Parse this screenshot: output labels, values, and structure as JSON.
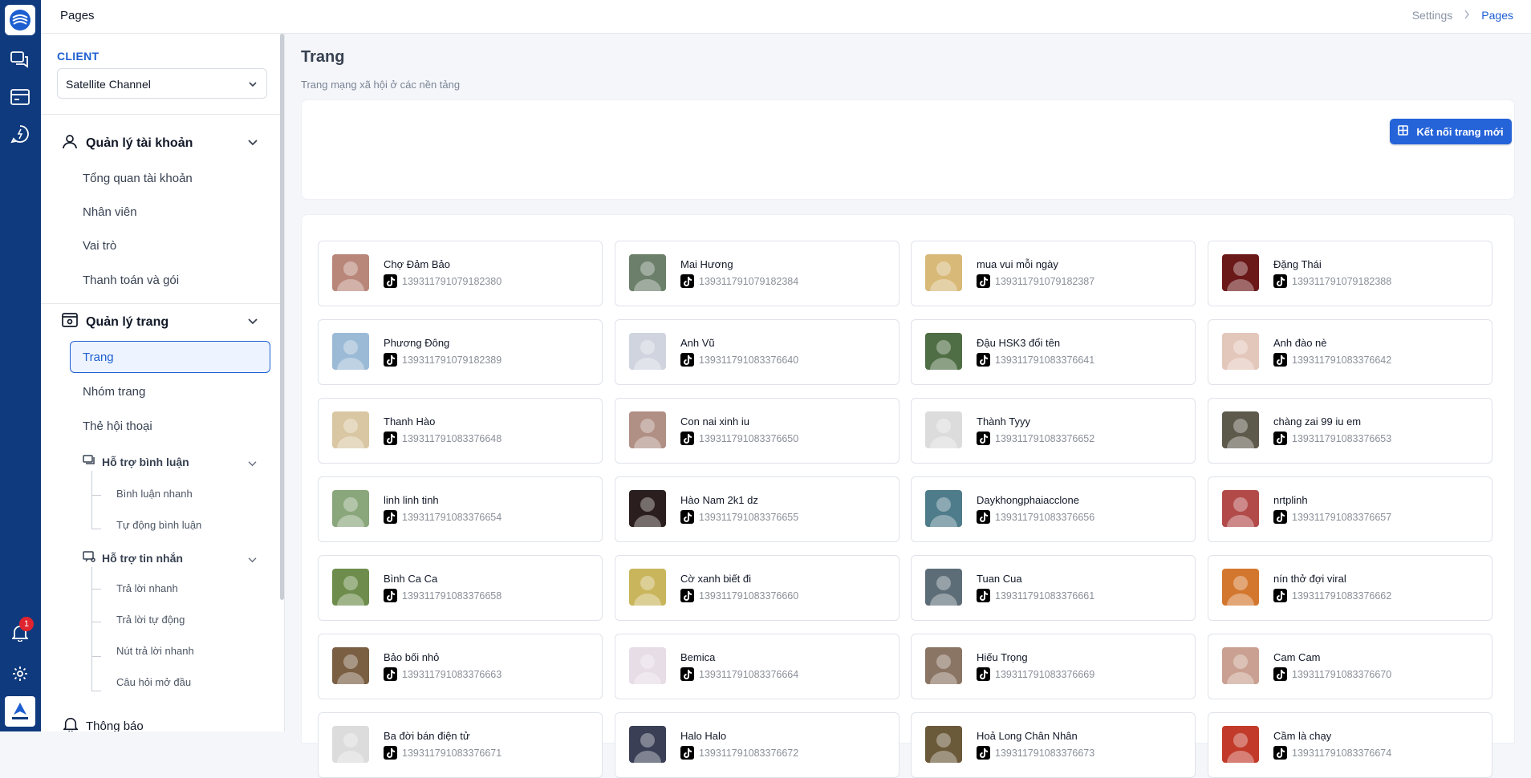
{
  "topbar": {
    "title": "Pages",
    "breadcrumb": [
      "Settings",
      "Pages"
    ]
  },
  "sidebar": {
    "client_label": "CLIENT",
    "client_value": "Satellite Channel",
    "account_group": {
      "title": "Quản lý tài khoản",
      "items": [
        "Tổng quan tài khoản",
        "Nhân viên",
        "Vai trò",
        "Thanh toán và gói"
      ]
    },
    "page_group": {
      "title": "Quản lý trang",
      "active": "Trang",
      "items": [
        "Nhóm trang",
        "Thẻ hội thoại"
      ]
    },
    "comment_support": {
      "title": "Hỗ trợ bình luận",
      "items": [
        "Bình luận nhanh",
        "Tự động bình luận"
      ]
    },
    "message_support": {
      "title": "Hỗ trợ tin nhắn",
      "items": [
        "Trả lời nhanh",
        "Trả lời tự động",
        "Nút trả lời nhanh",
        "Câu hỏi mở đầu"
      ]
    },
    "notifications": "Thông báo",
    "notification_count": "1"
  },
  "main": {
    "title": "Trang",
    "subtitle": "Trang mạng xã hội ở các nền tảng",
    "connect_button": "Kết nối trang mới",
    "pages": [
      {
        "name": "Chợ Đảm Bảo",
        "id": "139311791079182380",
        "color": "#b9877a"
      },
      {
        "name": "Mai Hương",
        "id": "139311791079182384",
        "color": "#6b7f6a"
      },
      {
        "name": "mua vui mỗi ngày",
        "id": "139311791079182387",
        "color": "#d8b978"
      },
      {
        "name": "Đặng Thái",
        "id": "139311791079182388",
        "color": "#6a1818"
      },
      {
        "name": "Phương Đông",
        "id": "139311791079182389",
        "color": "#9bbad6"
      },
      {
        "name": "Anh Vũ",
        "id": "139311791083376640",
        "color": "#cfd4df"
      },
      {
        "name": "Đậu HSK3 đổi tên",
        "id": "139311791083376641",
        "color": "#4f6e45"
      },
      {
        "name": "Anh đào nè",
        "id": "139311791083376642",
        "color": "#e3c7bb"
      },
      {
        "name": "Thanh Hào",
        "id": "139311791083376648",
        "color": "#d9c7a3"
      },
      {
        "name": "Con nai xinh iu",
        "id": "139311791083376650",
        "color": "#b08f84"
      },
      {
        "name": "Thành Tyyy",
        "id": "139311791083376652",
        "color": "#dcdcdc"
      },
      {
        "name": "chàng zai 99 iu em",
        "id": "139311791083376653",
        "color": "#5d5a4c"
      },
      {
        "name": "linh linh tinh",
        "id": "139311791083376654",
        "color": "#8aa67b"
      },
      {
        "name": "Hào Nam 2k1 dz",
        "id": "139311791083376655",
        "color": "#2b1e1e"
      },
      {
        "name": "Daykhongphaiacclone",
        "id": "139311791083376656",
        "color": "#4f7c8a"
      },
      {
        "name": "nrtplinh",
        "id": "139311791083376657",
        "color": "#b24a4a"
      },
      {
        "name": "Bình Ca Ca",
        "id": "139311791083376658",
        "color": "#6e8d4c"
      },
      {
        "name": "Cờ xanh biết đi",
        "id": "139311791083376660",
        "color": "#c9b55c"
      },
      {
        "name": "Tuan Cua",
        "id": "139311791083376661",
        "color": "#5c6d78"
      },
      {
        "name": "nín thở đợi viral",
        "id": "139311791083376662",
        "color": "#d3772e"
      },
      {
        "name": "Bảo bối nhỏ",
        "id": "139311791083376663",
        "color": "#7a5f43"
      },
      {
        "name": "Bemica",
        "id": "139311791083376664",
        "color": "#e6dde6"
      },
      {
        "name": "Hiếu Trọng",
        "id": "139311791083376669",
        "color": "#8a7464"
      },
      {
        "name": "Cam Cam",
        "id": "139311791083376670",
        "color": "#c9a091"
      },
      {
        "name": "Ba đời bán điện tử",
        "id": "139311791083376671",
        "color": "#dcdcdc"
      },
      {
        "name": "Halo Halo",
        "id": "139311791083376672",
        "color": "#3a3f56"
      },
      {
        "name": "Hoả Long Chân Nhân",
        "id": "139311791083376673",
        "color": "#6b5a3a"
      },
      {
        "name": "Cầm là chạy",
        "id": "139311791083376674",
        "color": "#c23b2a"
      }
    ]
  }
}
